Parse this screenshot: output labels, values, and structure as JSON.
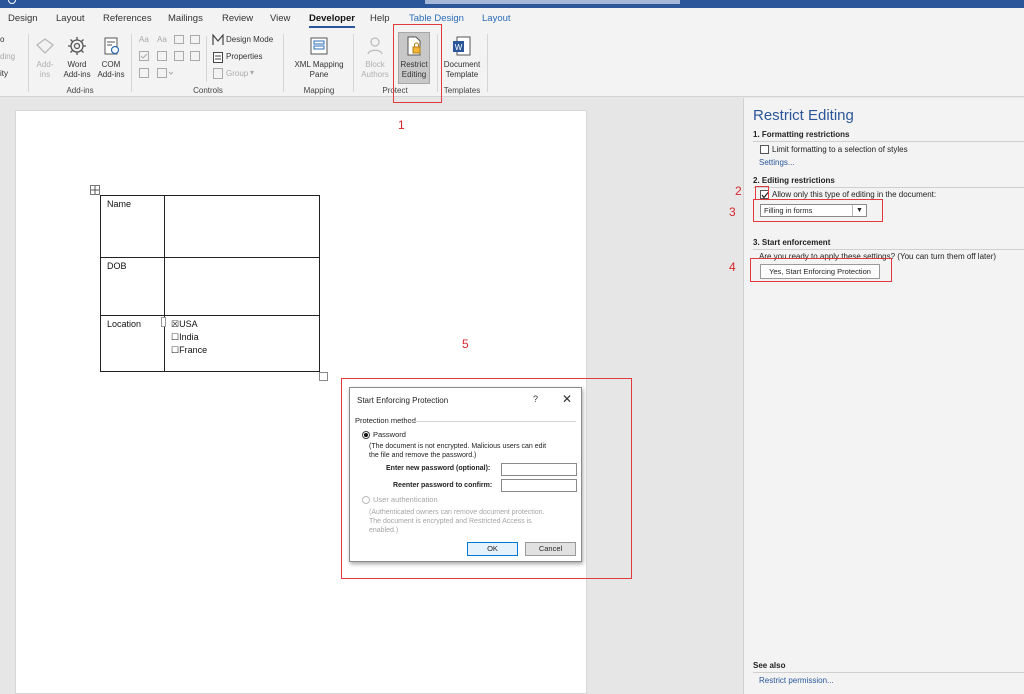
{
  "tabs": [
    {
      "label": "Design"
    },
    {
      "label": "Layout"
    },
    {
      "label": "References"
    },
    {
      "label": "Mailings"
    },
    {
      "label": "Review"
    },
    {
      "label": "View"
    },
    {
      "label": "Developer"
    },
    {
      "label": "Help"
    },
    {
      "label": "Table Design"
    },
    {
      "label": "Layout"
    }
  ],
  "ribbon": {
    "cut_left": [
      "o",
      "ding",
      "ity"
    ],
    "addins": {
      "label_1": "Add-",
      "label_2": "ins",
      "word_1": "Word",
      "word_2": "Add-ins",
      "com_1": "COM",
      "com_2": "Add-ins",
      "group": "Add-ins"
    },
    "controls": {
      "design_mode": "Design Mode",
      "properties": "Properties",
      "group_btn": "Group",
      "text_aa1": "Aa",
      "text_aa2": "Aa",
      "group": "Controls"
    },
    "mapping": {
      "xml_1": "XML Mapping",
      "xml_2": "Pane",
      "group": "Mapping"
    },
    "protect": {
      "block_1": "Block",
      "block_2": "Authors",
      "restrict_1": "Restrict",
      "restrict_2": "Editing",
      "group": "Protect"
    },
    "templates": {
      "doc_1": "Document",
      "doc_2": "Template",
      "group": "Templates"
    }
  },
  "document": {
    "rows": [
      {
        "label": "Name"
      },
      {
        "label": "DOB"
      },
      {
        "label": "Location"
      }
    ],
    "options": [
      {
        "label": "USA",
        "checked": "☒"
      },
      {
        "label": "India",
        "checked": "☐"
      },
      {
        "label": "France",
        "checked": "☐"
      }
    ]
  },
  "pane": {
    "title": "Restrict Editing",
    "s1_title": "1. Formatting restrictions",
    "s1_check": "Limit formatting to a selection of styles",
    "s1_link": "Settings...",
    "s2_title": "2. Editing restrictions",
    "s2_check": "Allow only this type of editing in the document:",
    "s2_dropdown": "Filling in forms",
    "s3_title": "3. Start enforcement",
    "s3_text": "Are you ready to apply these settings? (You can turn them off later)",
    "s3_button": "Yes, Start Enforcing Protection",
    "see_also": "See also",
    "see_also_link": "Restrict permission..."
  },
  "dialog": {
    "title": "Start Enforcing Protection",
    "help": "?",
    "close": "✕",
    "section": "Protection method",
    "password_label": "Password",
    "password_desc_1": "(The document is not encrypted. Malicious users can edit",
    "password_desc_2": "the file and remove the password.)",
    "new_pw_label": "Enter new password (optional):",
    "reenter_label": "Reenter password to confirm:",
    "user_auth_label": "User authentication",
    "user_auth_desc_1": "(Authenticated owners can remove document protection.",
    "user_auth_desc_2": "The document is encrypted and Restricted Access is",
    "user_auth_desc_3": "enabled.)",
    "ok": "OK",
    "cancel": "Cancel"
  },
  "annotations": [
    "1",
    "2",
    "3",
    "4",
    "5"
  ],
  "colors": {
    "accent": "#2b579a",
    "annotation": "#e0393e"
  }
}
